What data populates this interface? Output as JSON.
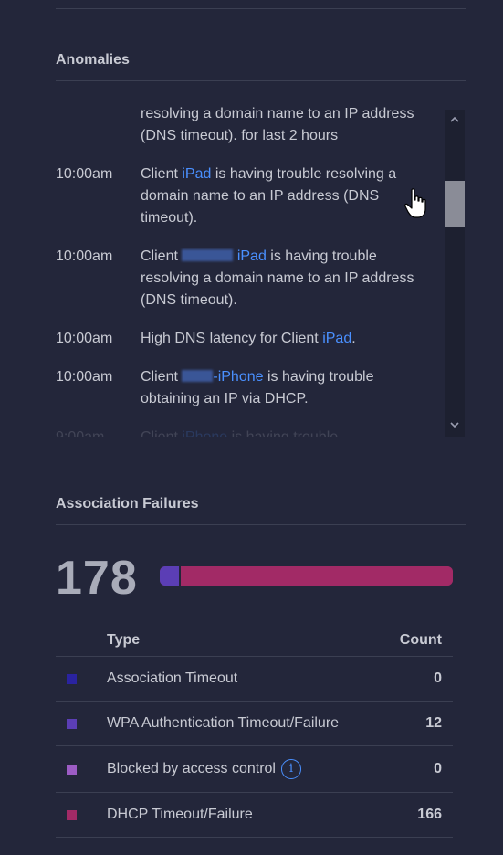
{
  "anomalies": {
    "title": "Anomalies",
    "items": [
      {
        "time": "",
        "pre": "resolving a domain name to an IP address (DNS timeout). for last 2 hours",
        "link": "",
        "post": ""
      },
      {
        "time": "10:00am",
        "pre": "Client ",
        "link": "iPad",
        "post": " is having trouble resolving a domain name to an IP address (DNS timeout)."
      },
      {
        "time": "10:00am",
        "pre": "Client ",
        "link": "iPad",
        "post": " is having trouble resolving a domain name to an IP address (DNS timeout)."
      },
      {
        "time": "10:00am",
        "pre": "High DNS latency for Client ",
        "link": "iPad",
        "post": "."
      },
      {
        "time": "10:00am",
        "pre": "Client ",
        "link": "-iPhone",
        "post": " is having trouble obtaining an IP via DHCP."
      },
      {
        "time": "9:00am",
        "pre": "Client ",
        "link": "iPhone",
        "post": " is having trouble"
      }
    ],
    "scroll_up_icon": "chevron-up-icon",
    "scroll_down_icon": "chevron-down-icon",
    "scroll_position": 0.35
  },
  "association_failures": {
    "title": "Association Failures",
    "total": "178",
    "columns": {
      "type": "Type",
      "count": "Count"
    },
    "rows": [
      {
        "type": "Association Timeout",
        "count": "0",
        "color": "#2a23a0"
      },
      {
        "type": "WPA Authentication Timeout/Failure",
        "count": "12",
        "color": "#5b3eb5"
      },
      {
        "type": "Blocked by access control",
        "count": "0",
        "color": "#9c5cc4",
        "info": "i"
      },
      {
        "type": "DHCP Timeout/Failure",
        "count": "166",
        "color": "#a22a66"
      }
    ]
  }
}
